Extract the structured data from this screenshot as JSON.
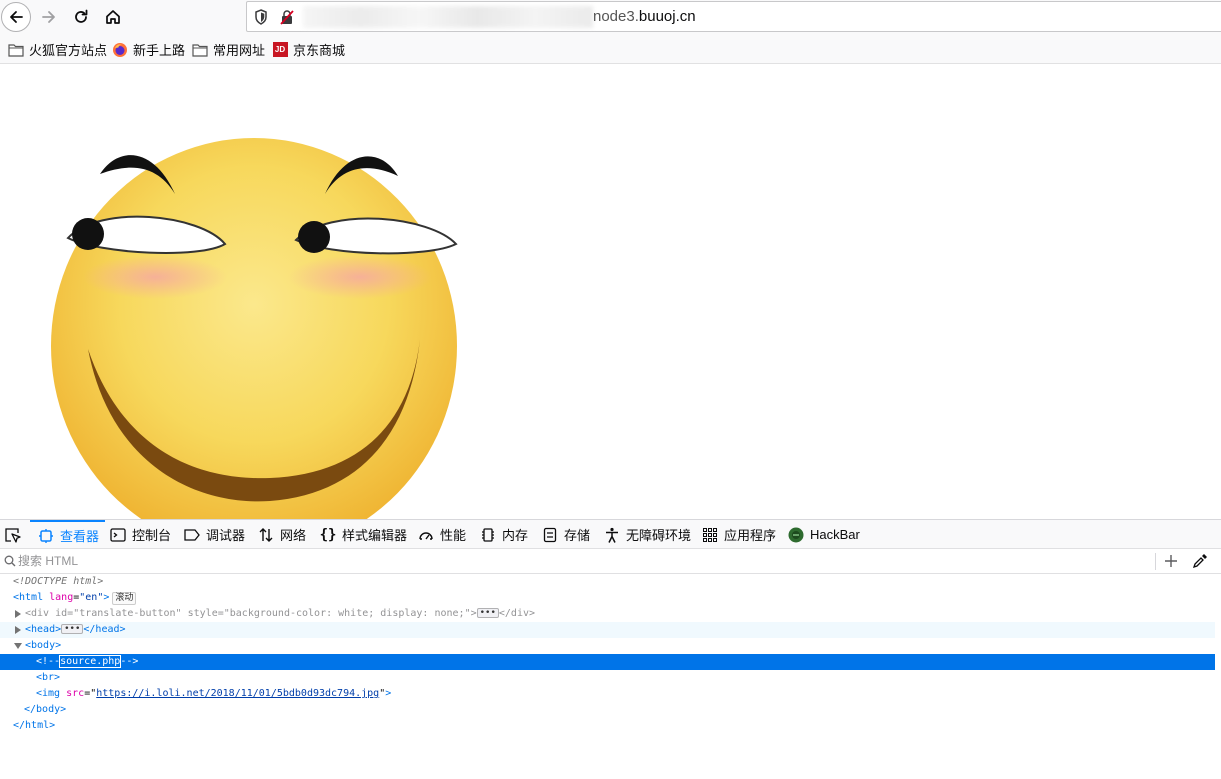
{
  "browser": {
    "url_visible": "node3.buuoj.cn",
    "url_prefix_visible": "node3.",
    "url_host_visible": "buuoj.cn",
    "bookmarks": [
      {
        "label": "火狐官方站点",
        "icon": "folder-icon"
      },
      {
        "label": "新手上路",
        "icon": "firefox-icon"
      },
      {
        "label": "常用网址",
        "icon": "folder-icon"
      },
      {
        "label": "京东商城",
        "icon": "jd-icon",
        "icon_text": "JD"
      }
    ]
  },
  "devtools": {
    "tabs": [
      {
        "label": "查看器",
        "icon": "inspector-icon",
        "active": true
      },
      {
        "label": "控制台",
        "icon": "console-icon"
      },
      {
        "label": "调试器",
        "icon": "debugger-icon"
      },
      {
        "label": "网络",
        "icon": "network-icon"
      },
      {
        "label": "样式编辑器",
        "icon": "style-editor-icon"
      },
      {
        "label": "性能",
        "icon": "performance-icon"
      },
      {
        "label": "内存",
        "icon": "memory-icon"
      },
      {
        "label": "存储",
        "icon": "storage-icon"
      },
      {
        "label": "无障碍环境",
        "icon": "accessibility-icon"
      },
      {
        "label": "应用程序",
        "icon": "application-icon"
      },
      {
        "label": "HackBar",
        "icon": "hackbar-icon"
      }
    ],
    "search_placeholder": "搜索 HTML",
    "markup": {
      "doctype": "<!DOCTYPE html>",
      "html_open_tag": "<html",
      "html_lang_attr": "lang",
      "html_lang_value": "\"en\"",
      "scroll_badge": "滚动",
      "div_tag": "<div",
      "div_id_attr": "id",
      "div_id_value": "\"translate-button\"",
      "div_style_attr": "style",
      "div_style_value": "\"background-color: white; display: none;\"",
      "div_close": "</div>",
      "head_open": "<head>",
      "head_close": "</head>",
      "body_open": "<body>",
      "comment_open": "<!--",
      "comment_text": "source.php",
      "comment_close": "-->",
      "br_tag": "<br>",
      "img_tag": "<img",
      "img_src_attr": "src",
      "img_src_value": "https://i.loli.net/2018/11/01/5bdb0d93dc794.jpg",
      "body_close": "</body>",
      "html_close": "</html>",
      "ellipsis": "•••"
    }
  },
  "colors": {
    "accent": "#0a84ff",
    "selected_row": "#0074e8",
    "tag": "#0074e8",
    "attr_name": "#dd00a9",
    "attr_value": "#003eaa"
  }
}
